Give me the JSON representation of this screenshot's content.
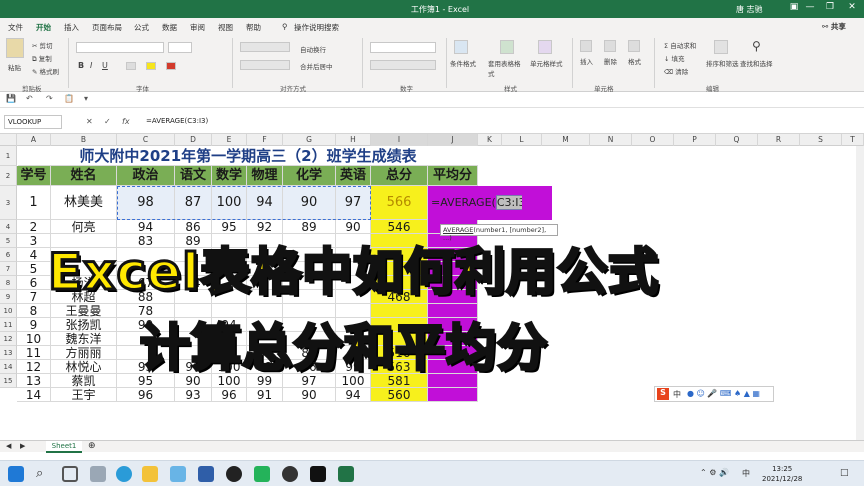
{
  "window": {
    "title": "工作簿1 - Excel",
    "user": "唐 志驰",
    "ribbon_display_icon": "▣",
    "minimize_icon": "—",
    "restore_icon": "❐",
    "close_icon": "✕"
  },
  "menu": {
    "tabs": [
      "文件",
      "开始",
      "插入",
      "页面布局",
      "公式",
      "数据",
      "审阅",
      "视图",
      "帮助"
    ],
    "active_tab": "开始",
    "search_placeholder": "操作说明搜索",
    "share": "共享"
  },
  "ribbon": {
    "clipboard": {
      "paste": "粘贴",
      "cut": "剪切",
      "copy": "复制",
      "format_painter": "格式刷",
      "label": "剪贴板"
    },
    "font": {
      "label": "字体"
    },
    "alignment": {
      "wrap": "自动换行",
      "merge": "合并后居中",
      "label": "对齐方式"
    },
    "number": {
      "label": "数字"
    },
    "styles": {
      "conditional": "条件格式",
      "table_format": "套用表格格式",
      "cell_styles": "单元格样式",
      "label": "样式"
    },
    "cells": {
      "insert": "插入",
      "delete": "删除",
      "format": "格式",
      "label": "单元格"
    },
    "editing": {
      "autosum": "自动求和",
      "fill": "填充",
      "clear": "清除",
      "sort_filter": "排序和筛选",
      "find_select": "查找和选择",
      "label": "编辑"
    }
  },
  "formula_bar": {
    "name_box": "VLOOKUP",
    "cancel": "✕",
    "enter": "✓",
    "fx": "fx",
    "formula": "=AVERAGE(C3:I3)"
  },
  "columns": [
    "A",
    "B",
    "C",
    "D",
    "E",
    "F",
    "G",
    "H",
    "I",
    "J",
    "K",
    "L",
    "M",
    "N",
    "O",
    "P",
    "Q",
    "R",
    "S",
    "T"
  ],
  "rows": [
    "1",
    "2",
    "3",
    "4",
    "5",
    "6",
    "7",
    "8",
    "9",
    "10",
    "11",
    "12",
    "13",
    "14",
    "15"
  ],
  "sheet": {
    "title": "师大附中2021年第一学期高三（2）班学生成绩表",
    "headers": [
      "学号",
      "姓名",
      "政治",
      "语文",
      "数学",
      "物理",
      "化学",
      "英语",
      "总分",
      "平均分"
    ],
    "data": [
      [
        "1",
        "林美美",
        "98",
        "87",
        "100",
        "94",
        "90",
        "97",
        "566"
      ],
      [
        "2",
        "何亮",
        "94",
        "86",
        "95",
        "92",
        "89",
        "90",
        "546"
      ],
      [
        "3",
        "",
        "83",
        "89",
        "",
        "",
        "",
        "",
        ""
      ],
      [
        "4",
        "",
        "",
        "",
        "",
        "",
        "",
        "",
        ""
      ],
      [
        "5",
        "",
        "",
        "",
        "",
        "",
        "",
        "",
        ""
      ],
      [
        "6",
        "杨洋",
        "67",
        "94",
        "",
        "",
        "",
        "",
        ""
      ],
      [
        "7",
        "林超",
        "88",
        "",
        "",
        "",
        "",
        "",
        "468"
      ],
      [
        "8",
        "王曼曼",
        "78",
        "",
        "",
        "",
        "",
        "",
        ""
      ],
      [
        "9",
        "张扬凯",
        "90",
        "",
        "94",
        "",
        "",
        "",
        ""
      ],
      [
        "10",
        "魏东洋",
        "",
        "",
        "",
        "",
        "",
        "",
        ""
      ],
      [
        "11",
        "方丽丽",
        "",
        "",
        "98",
        "85",
        "80",
        "",
        "516"
      ],
      [
        "12",
        "林悦心",
        "95",
        "90",
        "100",
        "98",
        "86",
        "99",
        "563"
      ],
      [
        "13",
        "蔡凯",
        "95",
        "90",
        "100",
        "99",
        "97",
        "100",
        "581"
      ],
      [
        "14",
        "王宇",
        "96",
        "93",
        "96",
        "91",
        "90",
        "94",
        "560"
      ]
    ],
    "edit_text": "=AVERAGE(",
    "edit_ref": "C3:I3)",
    "edit_ref_close": ")"
  },
  "tooltip": {
    "fn": "AVERAGE",
    "args": "(number1, [number2], ...)"
  },
  "overlay": {
    "line1": "Excel表格中如何利用公式",
    "line2": "计算总分和平均分"
  },
  "ime": {
    "logo": "S",
    "mode": "中"
  },
  "sheet_tab": "Sheet1",
  "taskbar": {
    "time": "13:25",
    "date": "2021/12/28",
    "lang": "中",
    "search_icon": "⌕"
  },
  "colors": {
    "header_green": "#7aae55",
    "sum_yellow": "#f7f01c",
    "avg_purple": "#c10fd8",
    "title_blue": "#1f3f86",
    "excel_green": "#217346"
  }
}
